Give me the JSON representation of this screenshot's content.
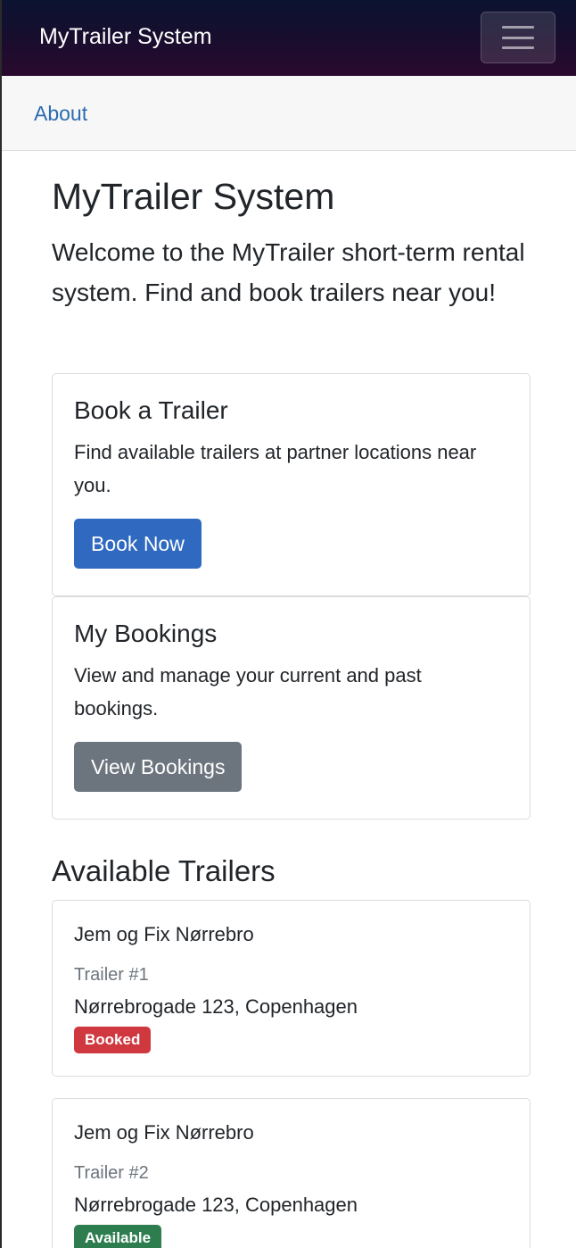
{
  "navbar": {
    "brand": "MyTrailer System",
    "toggler_icon": "hamburger-icon"
  },
  "subnav": {
    "about_label": "About"
  },
  "hero": {
    "title": "MyTrailer System",
    "lead": "Welcome to the MyTrailer short-term rental system. Find and book trailers near you!"
  },
  "cards": {
    "book": {
      "title": "Book a Trailer",
      "text": "Find available trailers at partner locations near you.",
      "button": "Book Now"
    },
    "bookings": {
      "title": "My Bookings",
      "text": "View and manage your current and past bookings.",
      "button": "View Bookings"
    }
  },
  "trailers_section": {
    "title": "Available Trailers",
    "items": [
      {
        "location": "Jem og Fix Nørrebro",
        "number": "Trailer #1",
        "address": "Nørrebrogade 123, Copenhagen",
        "status": "Booked"
      },
      {
        "location": "Jem og Fix Nørrebro",
        "number": "Trailer #2",
        "address": "Nørrebrogade 123, Copenhagen",
        "status": "Available"
      }
    ]
  },
  "colors": {
    "primary": "#306ac0",
    "secondary": "#6c757d",
    "booked": "#d0383f",
    "available": "#2e7d4f",
    "link": "#2b6cb0"
  }
}
